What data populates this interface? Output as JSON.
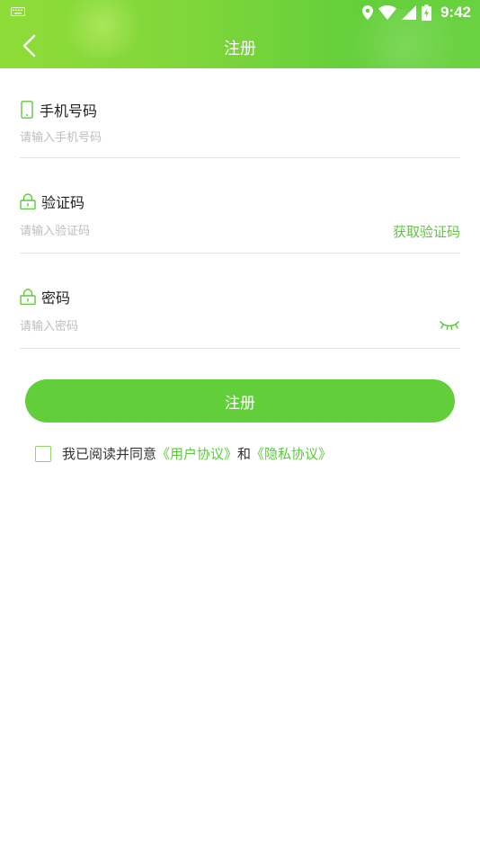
{
  "status_bar": {
    "time": "9:42"
  },
  "header": {
    "title": "注册"
  },
  "phone": {
    "label": "手机号码",
    "placeholder": "请输入手机号码",
    "value": ""
  },
  "code": {
    "label": "验证码",
    "placeholder": "请输入验证码",
    "value": "",
    "get_code_label": "获取验证码"
  },
  "password": {
    "label": "密码",
    "placeholder": "请输入密码",
    "value": ""
  },
  "register_button": {
    "label": "注册"
  },
  "agreement": {
    "prefix": "我已阅读并同意",
    "user_agreement": "《用户协议》",
    "conjunction": "和",
    "privacy_agreement": "《隐私协议》",
    "checked": false
  },
  "colors": {
    "accent": "#62cf3a",
    "link": "#5cc93b",
    "header_start": "#8fdc38",
    "header_end": "#63cf3a"
  }
}
